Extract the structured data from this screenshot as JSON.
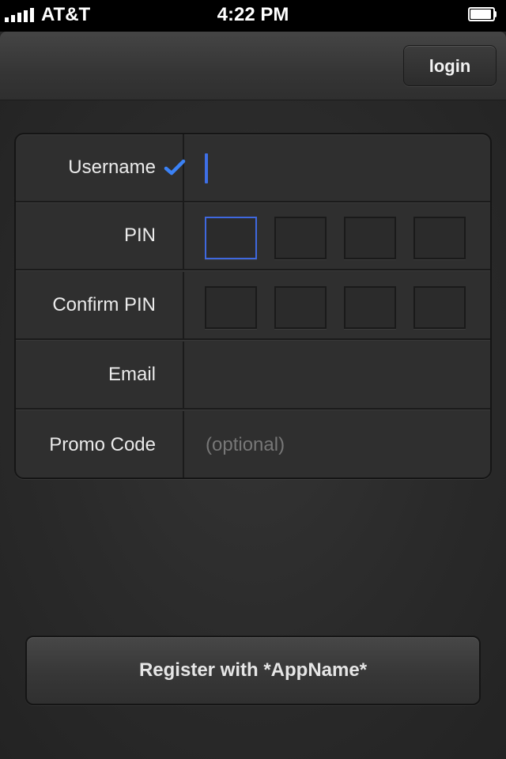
{
  "status_bar": {
    "carrier": "AT&T",
    "time": "4:22 PM",
    "signal_icon": "signal-bars-icon",
    "battery_icon": "battery-icon"
  },
  "nav": {
    "login_label": "login"
  },
  "form": {
    "rows": [
      {
        "label": "Username",
        "type": "text",
        "validated": true
      },
      {
        "label": "PIN",
        "type": "pin",
        "boxes": 4
      },
      {
        "label": "Confirm PIN",
        "type": "pin",
        "boxes": 4
      },
      {
        "label": "Email",
        "type": "text",
        "value": ""
      },
      {
        "label": "Promo Code",
        "type": "text",
        "placeholder": "(optional)"
      }
    ],
    "check_icon": "checkmark-icon"
  },
  "register_label": "Register with *AppName*",
  "colors": {
    "accent": "#3e6fe6",
    "check": "#3b82f6",
    "background": "#2b2b2b"
  }
}
